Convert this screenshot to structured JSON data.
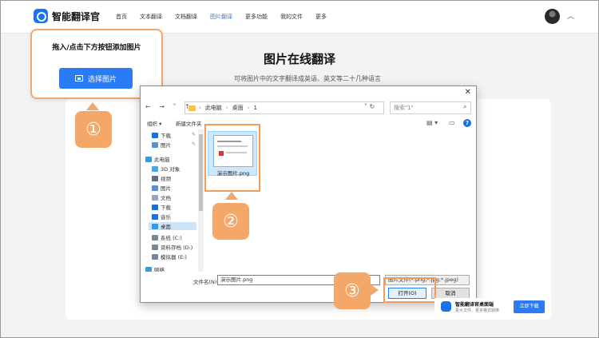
{
  "header": {
    "app_name": "智能翻译官",
    "nav": [
      "首页",
      "文本翻译",
      "文档翻译",
      "图片翻译",
      "更多功能",
      "我的文件",
      "更多"
    ],
    "active_nav": "图片翻译"
  },
  "main": {
    "title": "图片在线翻译",
    "subtitle": "可将图片中的文字翻译成英语、英文等二十几种语言"
  },
  "callout": {
    "text": "拖入/点击下方按钮添加图片",
    "button": "选择图片"
  },
  "steps": [
    "①",
    "②",
    "③"
  ],
  "dialog": {
    "close": "✕",
    "path": [
      "此电脑",
      "桌面",
      "1"
    ],
    "search_placeholder": "搜索\"1\"",
    "toolbar": {
      "organize": "组织 ▾",
      "new_folder": "新建文件夹"
    },
    "sidebar": [
      {
        "label": "下载",
        "icon": "download-icon",
        "color": "#1a6fd8",
        "pinned": true
      },
      {
        "label": "图片",
        "icon": "pictures-icon",
        "color": "#5a8fd0",
        "pinned": true
      },
      {
        "label": "此电脑",
        "icon": "pc-icon",
        "color": "#3a9ad9"
      },
      {
        "label": "3D 对象",
        "icon": "3d-objects-icon",
        "color": "#4da6e8"
      },
      {
        "label": "视频",
        "icon": "video-icon",
        "color": "#5a6f8a"
      },
      {
        "label": "图片",
        "icon": "pictures-icon",
        "color": "#5a8fd0"
      },
      {
        "label": "文档",
        "icon": "documents-icon",
        "color": "#9aa5b5"
      },
      {
        "label": "下载",
        "icon": "download-icon",
        "color": "#1a6fd8"
      },
      {
        "label": "音乐",
        "icon": "music-icon",
        "color": "#1a6fd8"
      },
      {
        "label": "桌面",
        "icon": "desktop-icon",
        "color": "#3a9ad9",
        "active": true
      },
      {
        "label": "系统 (C:)",
        "icon": "drive-icon",
        "color": "#7a8896"
      },
      {
        "label": "资料存档 (D:)",
        "icon": "drive-icon",
        "color": "#7a8896"
      },
      {
        "label": "模拟器 (E:)",
        "icon": "drive-icon",
        "color": "#7a8896"
      },
      {
        "label": "网络",
        "icon": "network-icon",
        "color": "#3a9ad9"
      }
    ],
    "file": {
      "name": "演示图片.png"
    },
    "filename_label": "文件名(N):",
    "filename_value": "演示图片.png",
    "filetype": "图片文件(*.png;*.jpg;*.jpeg)",
    "open_label": "打开(O)",
    "cancel_label": "取消"
  },
  "download": {
    "title": "智能翻译官桌面端",
    "subtitle": "更大文件、更多格式转换",
    "button": "立即下载"
  },
  "colors": {
    "accent": "#2a7cf6",
    "highlight": "#f3a86a"
  }
}
